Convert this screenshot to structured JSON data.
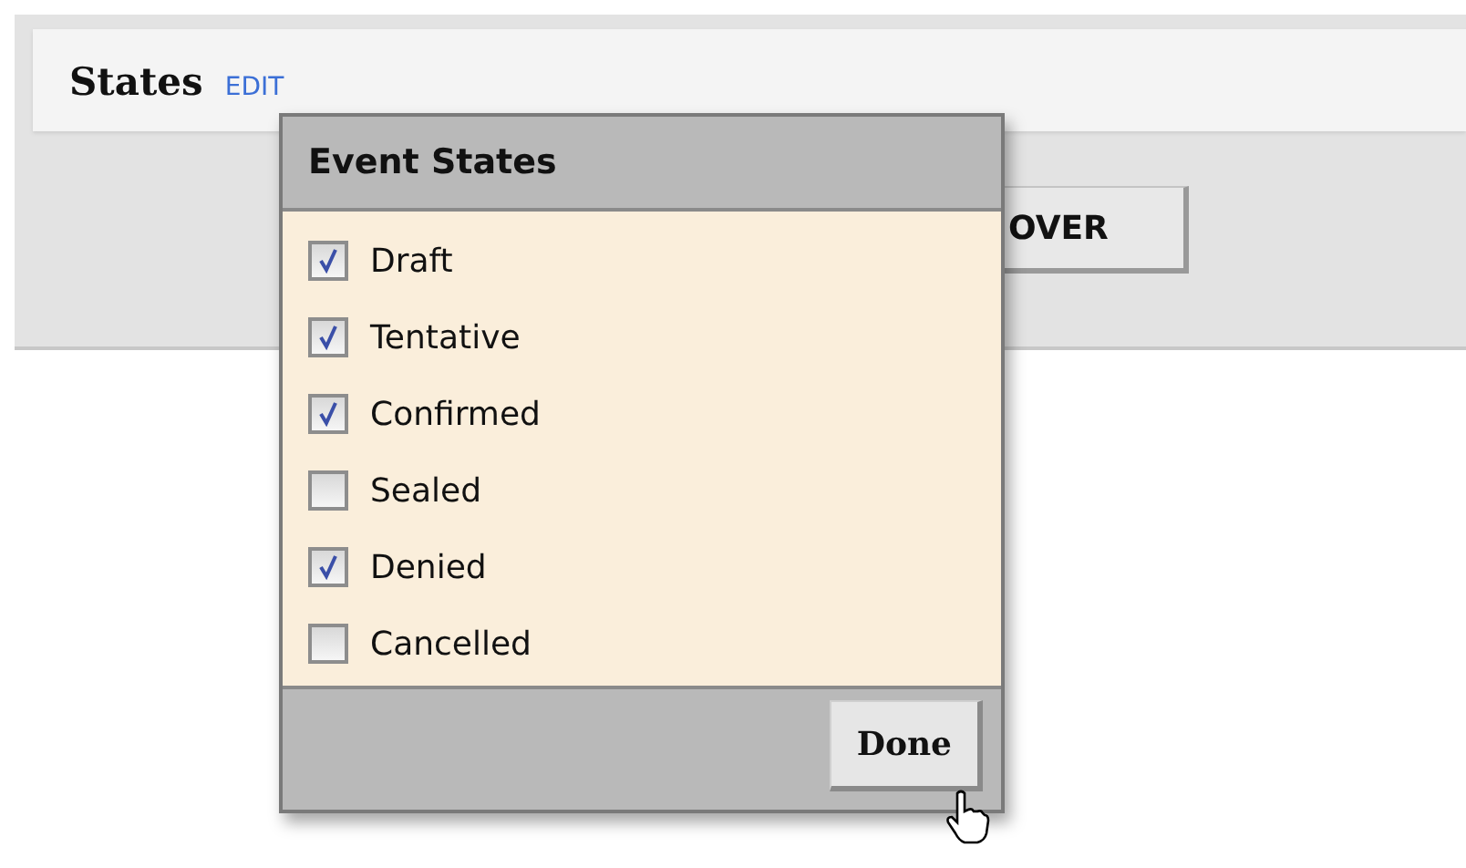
{
  "section": {
    "title": "States",
    "edit_link": "EDIT"
  },
  "background_button": {
    "label": "OVER"
  },
  "popup": {
    "title": "Event States",
    "options": [
      {
        "label": "Draft",
        "checked": true
      },
      {
        "label": "Tentative",
        "checked": true
      },
      {
        "label": "Confirmed",
        "checked": true
      },
      {
        "label": "Sealed",
        "checked": false
      },
      {
        "label": "Denied",
        "checked": true
      },
      {
        "label": "Cancelled",
        "checked": false
      }
    ],
    "done_button": "Done"
  }
}
